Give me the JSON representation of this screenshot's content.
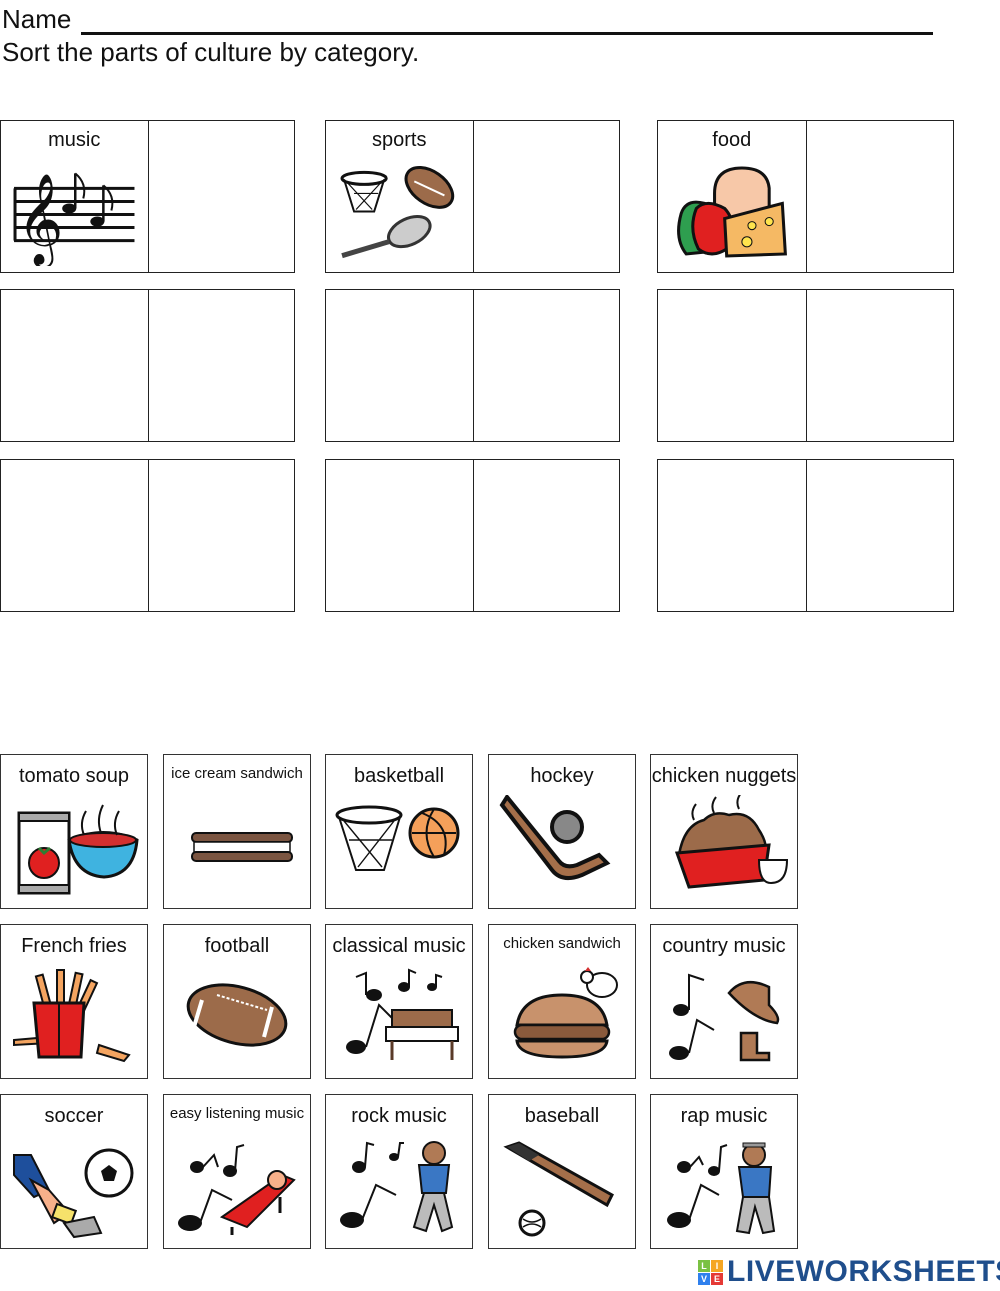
{
  "header": {
    "name_label": "Name",
    "instructions": "Sort the parts of culture by category."
  },
  "categories": [
    {
      "label": "music",
      "icon": "music-staff-icon"
    },
    {
      "label": "sports",
      "icon": "sports-equipment-icon"
    },
    {
      "label": "food",
      "icon": "food-group-icon"
    }
  ],
  "cards": [
    {
      "label": "tomato soup",
      "icon": "tomato-soup-icon"
    },
    {
      "label": "ice cream sandwich",
      "icon": "ice-cream-sandwich-icon",
      "small": true
    },
    {
      "label": "basketball",
      "icon": "basketball-icon"
    },
    {
      "label": "hockey",
      "icon": "hockey-icon"
    },
    {
      "label": "chicken nuggets",
      "icon": "chicken-nuggets-icon"
    },
    {
      "label": "French fries",
      "icon": "french-fries-icon"
    },
    {
      "label": "football",
      "icon": "football-icon"
    },
    {
      "label": "classical music",
      "icon": "classical-music-icon"
    },
    {
      "label": "chicken sandwich",
      "icon": "chicken-sandwich-icon",
      "small": true
    },
    {
      "label": "country music",
      "icon": "country-music-icon"
    },
    {
      "label": "soccer",
      "icon": "soccer-icon"
    },
    {
      "label": "easy listening music",
      "icon": "easy-listening-music-icon",
      "small": true
    },
    {
      "label": "rock music",
      "icon": "rock-music-icon"
    },
    {
      "label": "baseball",
      "icon": "baseball-icon"
    },
    {
      "label": "rap music",
      "icon": "rap-music-icon"
    }
  ],
  "footer": {
    "logo_blocks": [
      "L",
      "I",
      "V",
      "E"
    ],
    "logo_text": "LIVEWORKSHEETS",
    "logo_colors": [
      "#7ac143",
      "#f5a623",
      "#2f80ed",
      "#e53935"
    ],
    "brand_color": "#1f4e8c"
  }
}
